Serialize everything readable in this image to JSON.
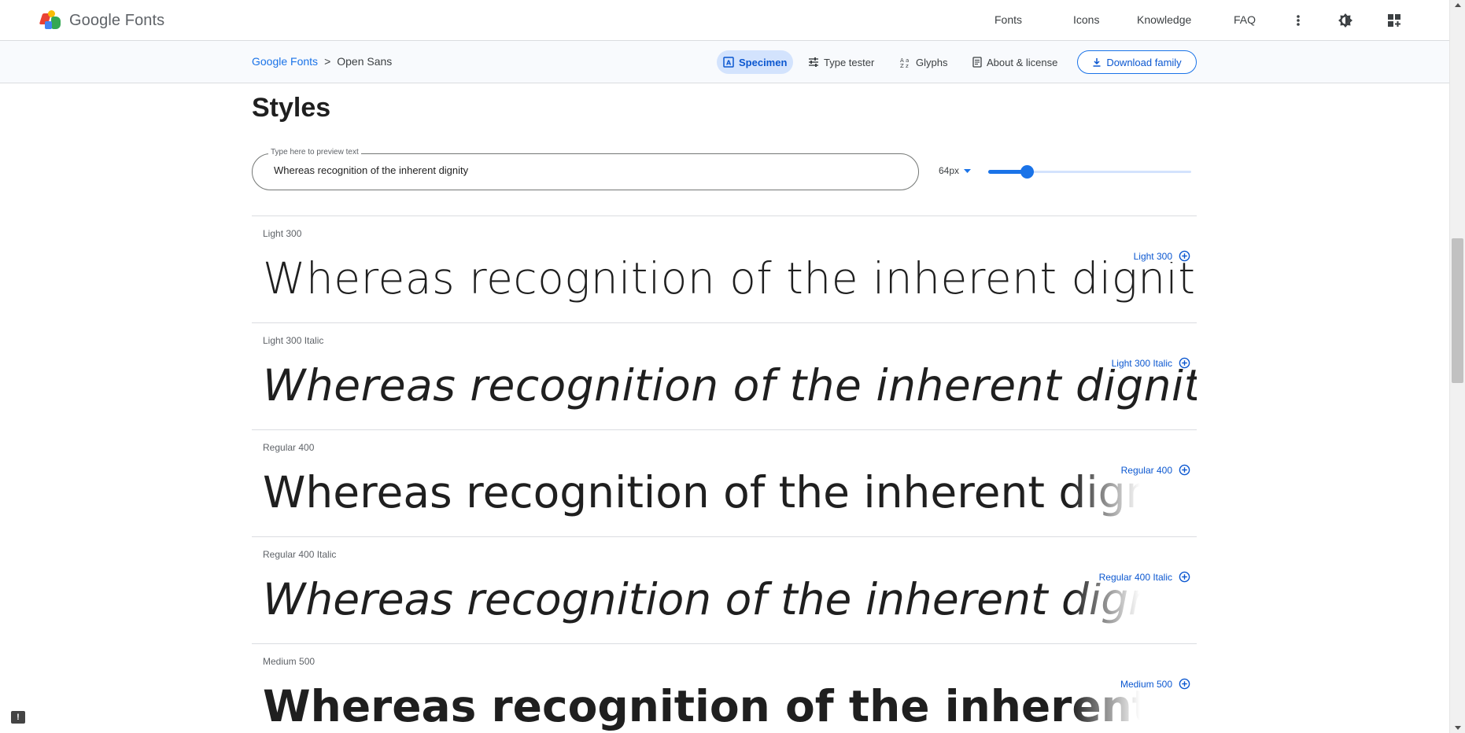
{
  "header": {
    "logo_text": "Google Fonts",
    "nav": [
      "Fonts",
      "Icons",
      "Knowledge",
      "FAQ"
    ],
    "icons": [
      "more-vert-icon",
      "theme-toggle-icon",
      "apps-icon"
    ]
  },
  "subheader": {
    "breadcrumb_root": "Google Fonts",
    "breadcrumb_sep": ">",
    "breadcrumb_current": "Open Sans",
    "tabs": [
      {
        "label": "Specimen",
        "icon": "specimen-icon",
        "active": true
      },
      {
        "label": "Type tester",
        "icon": "tune-icon",
        "active": false
      },
      {
        "label": "Glyphs",
        "icon": "glyphs-icon",
        "active": false
      },
      {
        "label": "About & license",
        "icon": "article-icon",
        "active": false
      }
    ],
    "download_label": "Download family"
  },
  "styles": {
    "title": "Styles",
    "preview_label": "Type here to preview text",
    "preview_value": "Whereas recognition of the inherent dignity",
    "size_value": "64px",
    "slider_fraction": 0.19,
    "rows": [
      {
        "name": "Light 300",
        "sample": "Whereas recognition of the inherent dignity",
        "action": "Light 300"
      },
      {
        "name": "Light 300 Italic",
        "sample": "Whereas recognition of the inherent dignity",
        "action": "Light 300 Italic"
      },
      {
        "name": "Regular 400",
        "sample": "Whereas recognition of the inherent dignity",
        "action": "Regular 400"
      },
      {
        "name": "Regular 400 Italic",
        "sample": "Whereas recognition of the inherent dignity",
        "action": "Regular 400 Italic"
      },
      {
        "name": "Medium 500",
        "sample": "Whereas recognition of the inherent dignity",
        "action": "Medium 500"
      }
    ]
  },
  "colors": {
    "accent": "#1a73e8",
    "active_tab_bg": "#d3e3fd"
  }
}
